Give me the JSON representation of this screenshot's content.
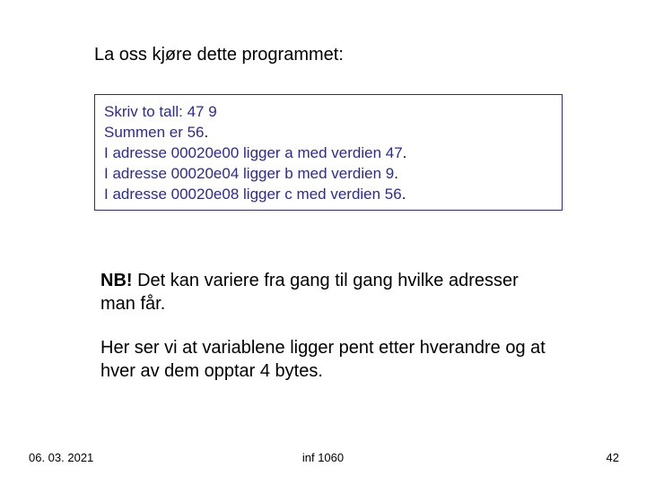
{
  "heading": "La oss kjøre dette programmet:",
  "output": {
    "lines": [
      {
        "pre": "Skriv to tall: 47 9",
        "dot": ""
      },
      {
        "pre": "Summen er 56",
        "dot": "."
      },
      {
        "pre": "I adresse 00020e00 ligger a med verdien 47",
        "dot": "."
      },
      {
        "pre": "I adresse 00020e04 ligger b med verdien 9",
        "dot": "."
      },
      {
        "pre": "I adresse 00020e08 ligger c med verdien 56",
        "dot": "."
      }
    ]
  },
  "notes": {
    "nb_label": "NB!",
    "nb_text": "  Det kan variere fra gang til gang hvilke adresser man får.",
    "para2": "Her ser vi at variablene ligger pent etter hverandre og at hver av dem opptar 4 bytes."
  },
  "footer": {
    "date": "06. 03. 2021",
    "center": "inf 1060",
    "page": "42"
  }
}
